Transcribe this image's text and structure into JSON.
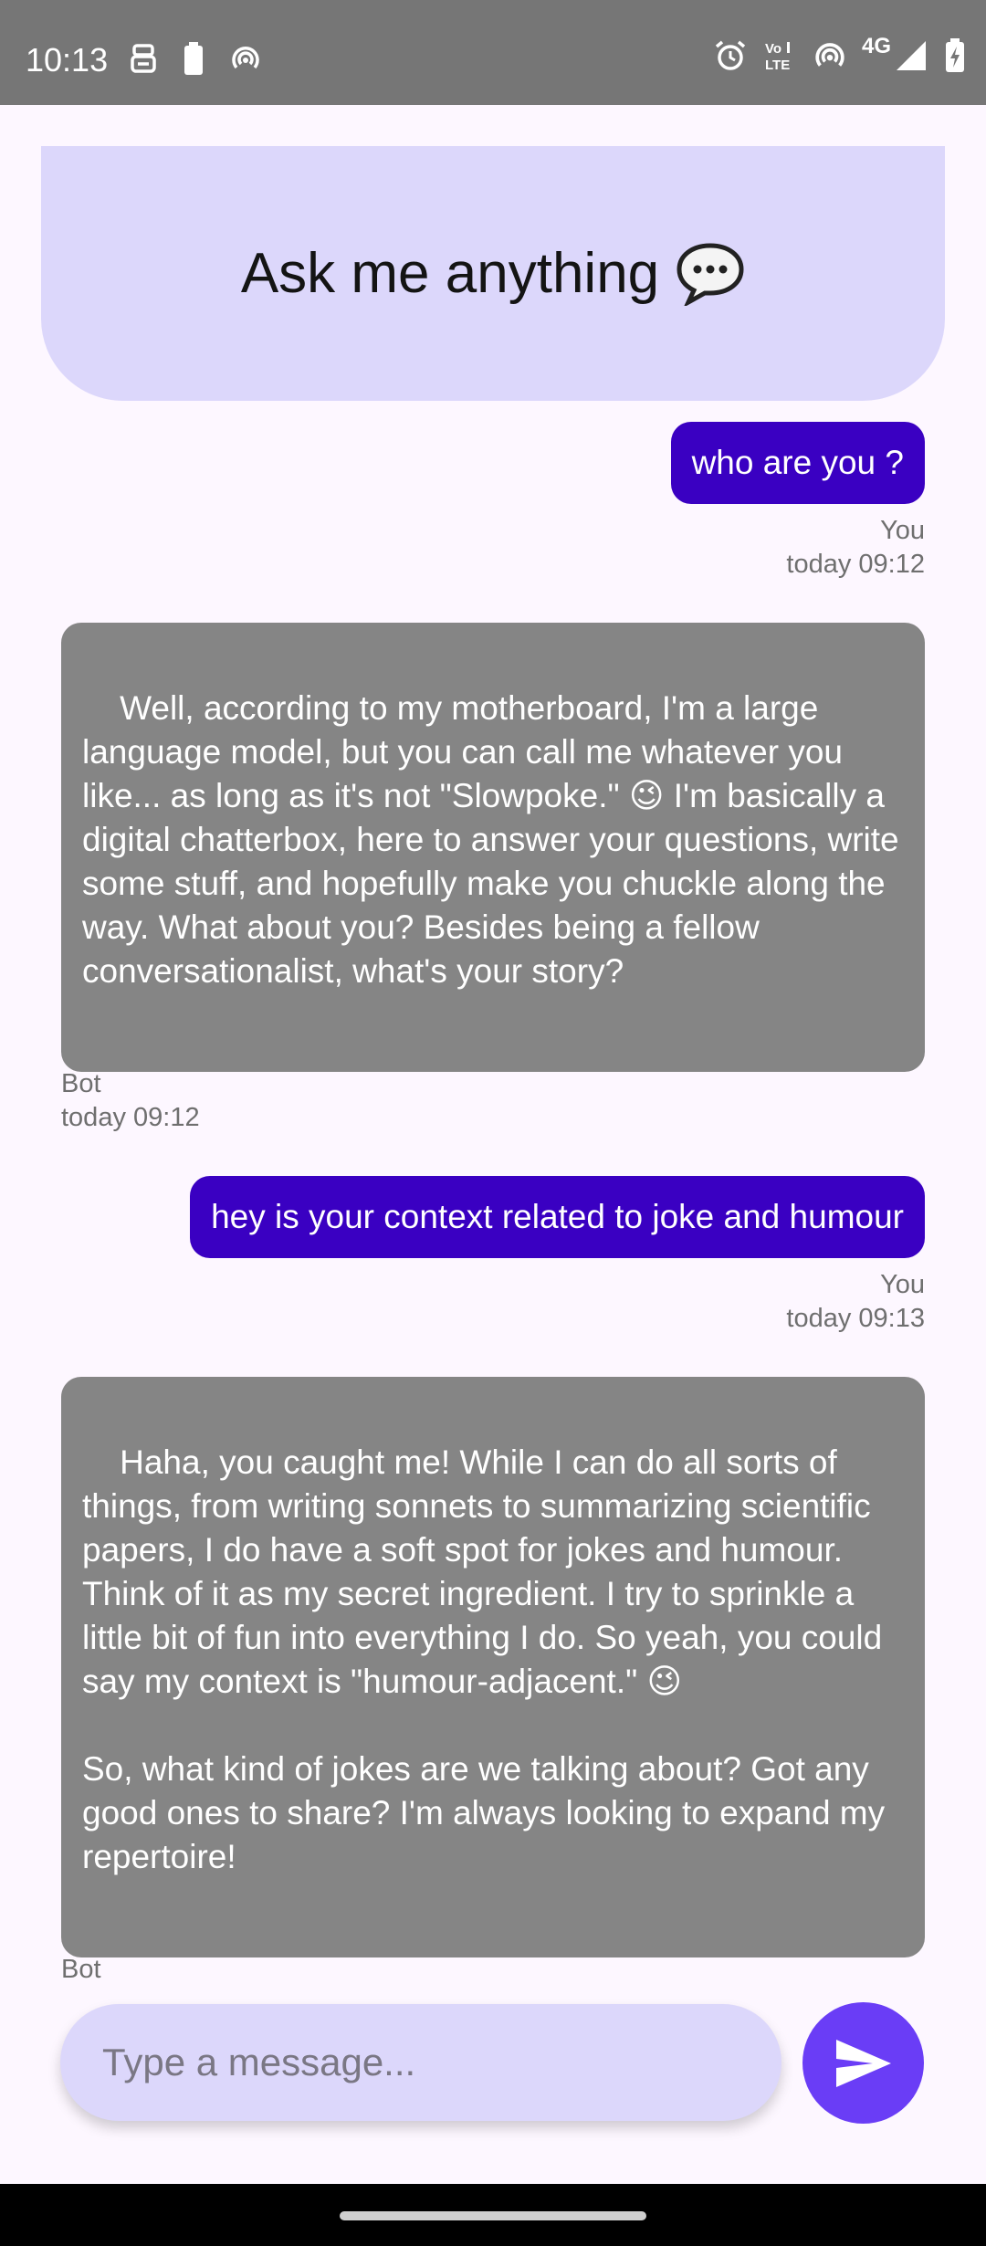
{
  "status_bar": {
    "time": "10:13",
    "network": "4G",
    "left_icons": [
      "vpn-icon",
      "battery-saver-icon",
      "hotspot-icon"
    ],
    "right_icons": [
      "alarm-icon",
      "volte-icon",
      "hotspot-icon",
      "signal-icon",
      "battery-icon"
    ]
  },
  "header": {
    "title": "Ask me anything",
    "icon": "speech-bubble-icon"
  },
  "messages": [
    {
      "sender": "user",
      "text": "who are you ?",
      "author": "You",
      "time": "today 09:12"
    },
    {
      "sender": "bot",
      "text": "Well, according to my motherboard, I'm a large language model, but you can call me whatever you like... as long as it's not \"Slowpoke.\" 😉 I'm basically a digital chatterbox, here to answer your questions, write some stuff, and hopefully make you chuckle along the way. What about you? Besides being a fellow conversationalist, what's your story?",
      "author": "Bot",
      "time": "today 09:12"
    },
    {
      "sender": "user",
      "text": "hey is your context related to joke and humour",
      "author": "You",
      "time": "today 09:13"
    },
    {
      "sender": "bot",
      "text": "Haha, you caught me! While I can do all sorts of things, from writing sonnets to summarizing scientific papers, I do have a soft spot for jokes and humour. Think of it as my secret ingredient. I try to sprinkle a little bit of fun into everything I do. So yeah, you could say my context is \"humour-adjacent.\" 😉\n\nSo, what kind of jokes are we talking about? Got any good ones to share? I'm always looking to expand my repertoire!",
      "author": "Bot",
      "time": ""
    }
  ],
  "composer": {
    "placeholder": "Type a message...",
    "value": "",
    "send_icon": "send-icon"
  },
  "colors": {
    "status_bar": "#767676",
    "background": "#fdf7ff",
    "header_card": "#dcd7fb",
    "user_bubble": "#3a00c2",
    "bot_bubble": "#858585",
    "send_button": "#6a3df6"
  }
}
